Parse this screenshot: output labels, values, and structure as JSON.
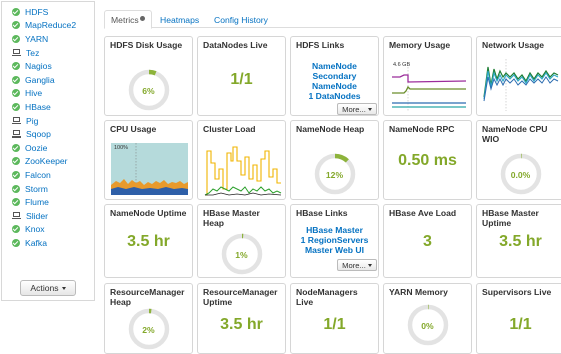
{
  "sidebar": {
    "services": [
      {
        "name": "HDFS",
        "icon": "ok"
      },
      {
        "name": "MapReduce2",
        "icon": "ok"
      },
      {
        "name": "YARN",
        "icon": "ok"
      },
      {
        "name": "Tez",
        "icon": "client"
      },
      {
        "name": "Nagios",
        "icon": "ok"
      },
      {
        "name": "Ganglia",
        "icon": "ok"
      },
      {
        "name": "Hive",
        "icon": "ok"
      },
      {
        "name": "HBase",
        "icon": "ok"
      },
      {
        "name": "Pig",
        "icon": "client"
      },
      {
        "name": "Sqoop",
        "icon": "client"
      },
      {
        "name": "Oozie",
        "icon": "ok"
      },
      {
        "name": "ZooKeeper",
        "icon": "ok"
      },
      {
        "name": "Falcon",
        "icon": "ok"
      },
      {
        "name": "Storm",
        "icon": "ok"
      },
      {
        "name": "Flume",
        "icon": "ok"
      },
      {
        "name": "Slider",
        "icon": "client"
      },
      {
        "name": "Knox",
        "icon": "ok"
      },
      {
        "name": "Kafka",
        "icon": "ok"
      }
    ],
    "actions_label": "Actions"
  },
  "tabs": [
    {
      "label": "Metrics",
      "active": true
    },
    {
      "label": "Heatmaps",
      "active": false
    },
    {
      "label": "Config History",
      "active": false
    }
  ],
  "widgets": {
    "hdfs_disk_usage": {
      "title": "HDFS Disk Usage",
      "value": "6%",
      "percent": 6
    },
    "datanodes_live": {
      "title": "DataNodes Live",
      "value": "1/1"
    },
    "hdfs_links": {
      "title": "HDFS Links",
      "links": [
        "NameNode",
        "Secondary NameNode",
        "1 DataNodes"
      ],
      "more_label": "More..."
    },
    "memory_usage": {
      "title": "Memory Usage",
      "chart_label": "4.6 GB"
    },
    "network_usage": {
      "title": "Network Usage"
    },
    "cpu_usage": {
      "title": "CPU Usage",
      "chart_label": "100%"
    },
    "cluster_load": {
      "title": "Cluster Load"
    },
    "namenode_heap": {
      "title": "NameNode Heap",
      "value": "12%",
      "percent": 12
    },
    "namenode_rpc": {
      "title": "NameNode RPC",
      "value": "0.50 ms"
    },
    "namenode_cpu_wio": {
      "title": "NameNode CPU WIO",
      "value": "0.0%",
      "percent": 0
    },
    "namenode_uptime": {
      "title": "NameNode Uptime",
      "value": "3.5 hr"
    },
    "hbase_master_heap": {
      "title": "HBase Master Heap",
      "value": "1%",
      "percent": 1
    },
    "hbase_links": {
      "title": "HBase Links",
      "links": [
        "HBase Master",
        "1 RegionServers",
        "Master Web UI"
      ],
      "more_label": "More..."
    },
    "hbase_ave_load": {
      "title": "HBase Ave Load",
      "value": "3"
    },
    "hbase_master_uptime": {
      "title": "HBase Master Uptime",
      "value": "3.5 hr"
    },
    "rm_heap": {
      "title": "ResourceManager Heap",
      "value": "2%",
      "percent": 2
    },
    "rm_uptime": {
      "title": "ResourceManager Uptime",
      "value": "3.5 hr"
    },
    "nodemanagers_live": {
      "title": "NodeManagers Live",
      "value": "1/1"
    },
    "yarn_memory": {
      "title": "YARN Memory",
      "value": "0%",
      "percent": 0
    },
    "supervisors_live": {
      "title": "Supervisors Live",
      "value": "1/1"
    }
  },
  "colors": {
    "link": "#0572c2",
    "metric_value": "#83a82a",
    "ok_status": "#5cb85c",
    "donut_track": "#e3e3e3",
    "donut_fill": "#8db33b"
  }
}
